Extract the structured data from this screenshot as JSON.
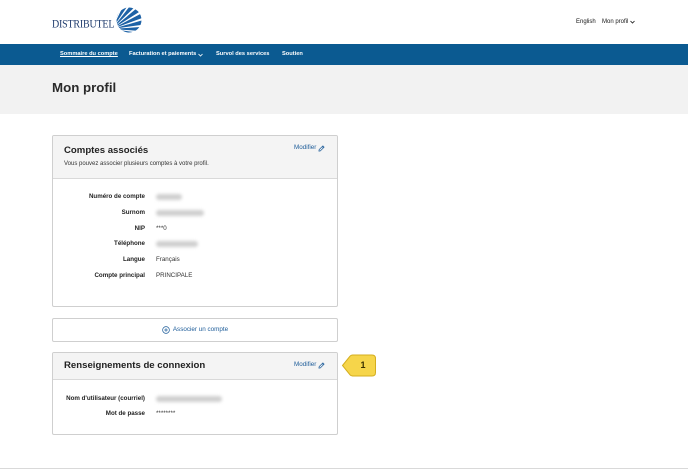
{
  "colors": {
    "nav_background": "#0b5a91",
    "link": "#1d5c99",
    "title_band": "#f2f2f2",
    "card_header": "#f4f4f4",
    "callout": "#f6d54a"
  },
  "header": {
    "logo_text": "DISTRIBUTEL",
    "logo_icon": "sunburst-logo-icon",
    "language_link": "English",
    "profile_menu": {
      "label": "Mon profil",
      "icon": "chevron-down-icon"
    }
  },
  "nav": {
    "items": [
      {
        "label": "Sommaire du compte",
        "active": true
      },
      {
        "label": "Facturation et paiements",
        "has_dropdown": true,
        "icon": "chevron-down-icon"
      },
      {
        "label": "Survol des services"
      },
      {
        "label": "Soutien"
      }
    ]
  },
  "page": {
    "title": "Mon profil"
  },
  "linked_accounts": {
    "title": "Comptes associés",
    "subtitle": "Vous pouvez associer plusieurs comptes à votre profil.",
    "edit": {
      "label": "Modifier",
      "icon": "pencil-icon"
    },
    "fields": [
      {
        "label": "Numéro de compte",
        "redacted": true
      },
      {
        "label": "Surnom",
        "redacted": true
      },
      {
        "label": "NIP",
        "value": "***0"
      },
      {
        "label": "Téléphone",
        "redacted": true
      },
      {
        "label": "Langue",
        "value": "Français"
      },
      {
        "label": "Compte principal",
        "value": "PRINCIPALE"
      }
    ]
  },
  "add_account_button": {
    "label": "Associer un compte",
    "icon": "plus-circle-icon"
  },
  "login_info": {
    "title": "Renseignements de connexion",
    "edit": {
      "label": "Modifier",
      "icon": "pencil-icon"
    },
    "fields": [
      {
        "label": "Nom d'utilisateur (courriel)",
        "redacted": true
      },
      {
        "label": "Mot de passe",
        "value": "********"
      }
    ]
  },
  "annotation": {
    "callout_number": "1"
  }
}
